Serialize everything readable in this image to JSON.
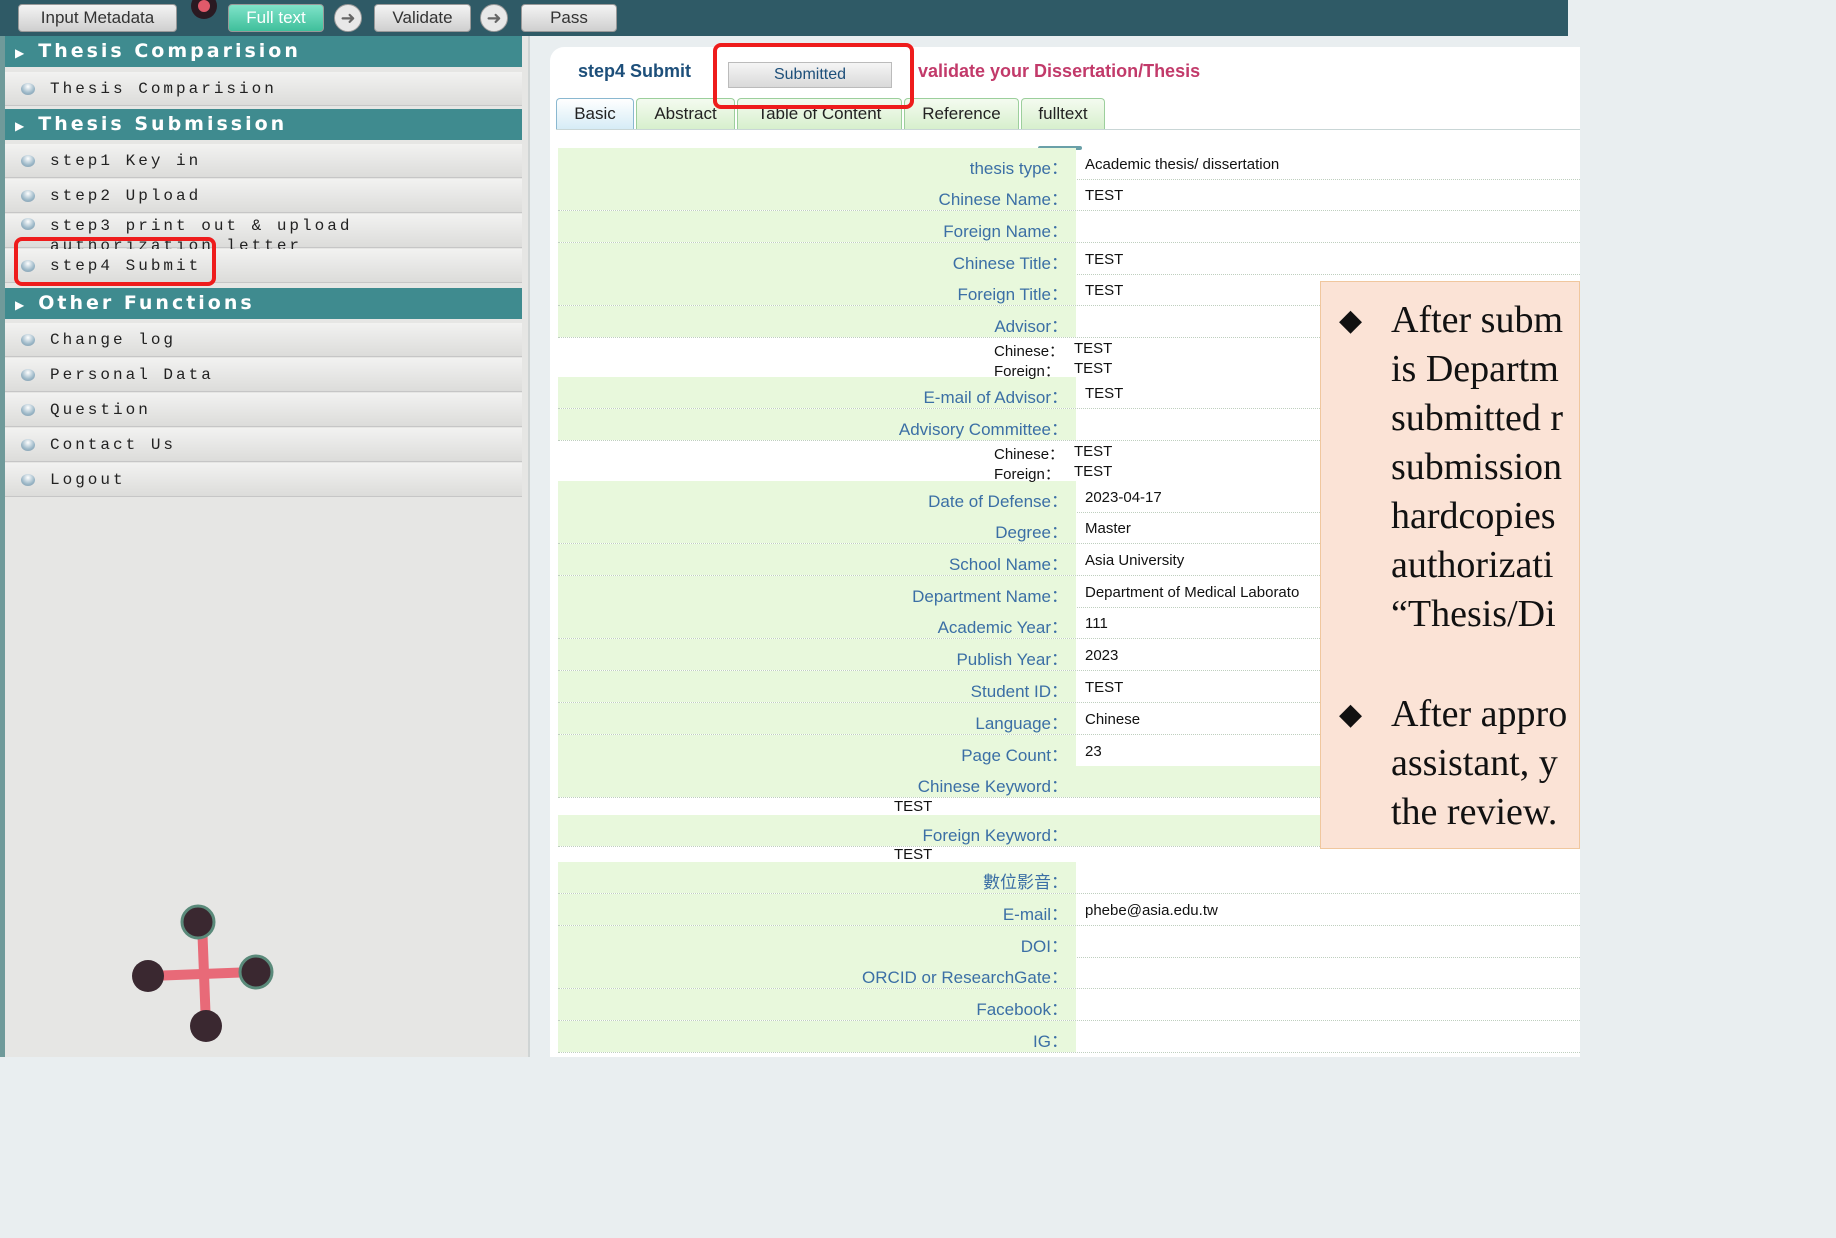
{
  "progress": {
    "steps": [
      "Input Metadata",
      "Full text",
      "Validate",
      "Pass"
    ],
    "active_index": 1
  },
  "sidebar": {
    "sections": [
      {
        "title": "Thesis Comparision",
        "items": [
          "Thesis Comparision"
        ]
      },
      {
        "title": "Thesis Submission",
        "items": [
          "step1 Key in",
          "step2 Upload",
          "step3 print out & upload authorization letter",
          "step4 Submit"
        ]
      },
      {
        "title": "Other Functions",
        "items": [
          "Change log",
          "Personal Data",
          "Question",
          "Contact Us",
          "Logout"
        ]
      }
    ]
  },
  "main": {
    "step_title": "step4 Submit",
    "status_button": "Submitted",
    "instruction": "validate your Dissertation/Thesis",
    "tabs": [
      "Basic",
      "Abstract",
      "Table of Content",
      "Reference",
      "fulltext"
    ],
    "active_tab": "Basic",
    "fields": [
      {
        "label": "thesis type：",
        "value": "Academic thesis/ dissertation"
      },
      {
        "label": "Chinese Name：",
        "value": "TEST"
      },
      {
        "label": "Foreign Name：",
        "value": ""
      },
      {
        "label": "Chinese Title：",
        "value": "TEST"
      },
      {
        "label": "Foreign Title：",
        "value": "TEST"
      },
      {
        "label": "Advisor：",
        "value": ""
      },
      {
        "label": "E-mail of Advisor：",
        "value": "TEST"
      },
      {
        "label": "Advisory Committee：",
        "value": ""
      },
      {
        "label": "Date of Defense：",
        "value": "2023-04-17"
      },
      {
        "label": "Degree：",
        "value": "Master"
      },
      {
        "label": "School Name：",
        "value": "Asia University"
      },
      {
        "label": "Department Name：",
        "value": "Department of Medical Laborato"
      },
      {
        "label": "Academic Year：",
        "value": "111"
      },
      {
        "label": "Publish Year：",
        "value": "2023"
      },
      {
        "label": "Student ID：",
        "value": "TEST"
      },
      {
        "label": "Language：",
        "value": "Chinese"
      },
      {
        "label": "Page Count：",
        "value": "23"
      },
      {
        "label": "Chinese Keyword：",
        "value": ""
      },
      {
        "label": "Foreign Keyword：",
        "value": ""
      },
      {
        "label": "數位影音：",
        "value": ""
      },
      {
        "label": "E-mail：",
        "value": "phebe@asia.edu.tw"
      },
      {
        "label": "DOI：",
        "value": ""
      },
      {
        "label": "ORCID or ResearchGate：",
        "value": ""
      },
      {
        "label": "Facebook：",
        "value": ""
      },
      {
        "label": "IG：",
        "value": ""
      }
    ],
    "advisor_sub": [
      {
        "label": "Chinese：",
        "value": "TEST"
      },
      {
        "label": "Foreign：",
        "value": "TEST"
      }
    ],
    "committee_sub": [
      {
        "label": "Chinese：",
        "value": "TEST"
      },
      {
        "label": "Foreign：",
        "value": "TEST"
      }
    ],
    "chinese_keyword_value": "TEST",
    "foreign_keyword_value": "TEST"
  },
  "note": {
    "bullet1_lines": [
      "After subm",
      "is Departm",
      "submitted r",
      "submission",
      "hardcopies",
      "authorizati",
      "“Thesis/Di"
    ],
    "bullet2_lines": [
      "After appro",
      "assistant, y",
      "the review."
    ]
  },
  "colors": {
    "header_bg": "#2f5a66",
    "section_bg": "#3f8b8f",
    "label_blue": "#3b6fa5",
    "highlight_red": "#ee1c1c",
    "instruction_pink": "#c23a6a"
  }
}
